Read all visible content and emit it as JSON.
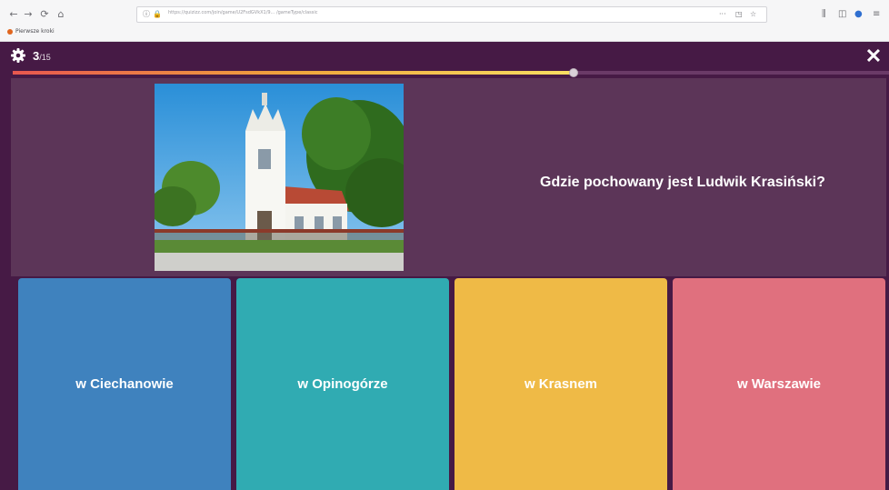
{
  "browser": {
    "back": "←",
    "forward": "→",
    "reload": "⟳",
    "home": "⌂",
    "url": "https://quizizz.com/join/game/U2FsdGVkX1/9... /gameType/classic",
    "page_actions": "···",
    "bookmark": "Pierwsze kroki"
  },
  "quiz": {
    "question_number": "3",
    "question_total": "/15",
    "progress_fraction": 0.64,
    "question": "Gdzie pochowany jest Ludwik Krasiński?",
    "answers": [
      {
        "label": "w Ciechanowie",
        "color": "#3f82be"
      },
      {
        "label": "w Opinogórze",
        "color": "#30abb2"
      },
      {
        "label": "w Krasnem",
        "color": "#efba46"
      },
      {
        "label": "w Warszawie",
        "color": "#e0707e"
      }
    ],
    "close_symbol": "✕"
  },
  "colors": {
    "header_bg": "#461a45",
    "panel_bg": "#5c3558"
  },
  "icons": {
    "settings": "gear-icon",
    "close": "close-icon",
    "image": "church-photo"
  }
}
